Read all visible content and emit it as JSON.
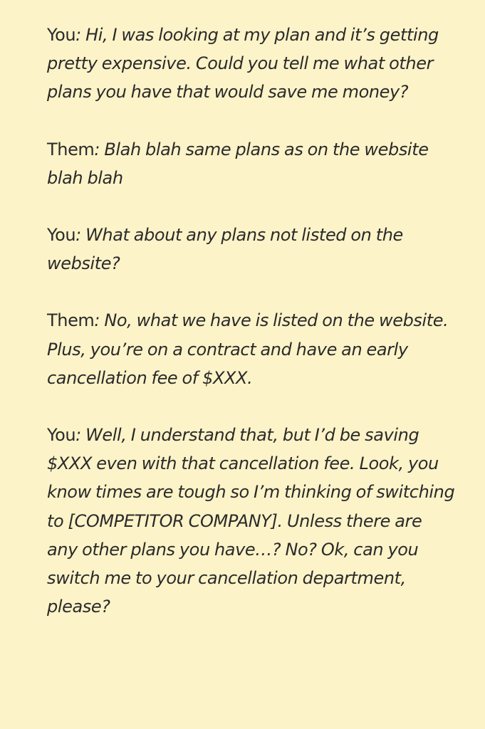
{
  "conversation": [
    {
      "speaker": "You",
      "text": "Hi, I was looking at my plan and it’s getting pretty expensive. Could you tell me what other plans you have that would save me money?"
    },
    {
      "speaker": "Them",
      "text": "Blah blah same plans as on the website blah blah"
    },
    {
      "speaker": "You",
      "text": "What about any plans not listed on the website?"
    },
    {
      "speaker": "Them",
      "text": "No, what we have is listed on the website. Plus, you’re on a contract and have an early cancellation fee of $XXX."
    },
    {
      "speaker": "You",
      "text": "Well, I understand that, but I’d be saving $XXX even with that cancellation fee. Look, you know times are tough so I’m thinking of switching to [COMPETITOR COMPANY]. Unless there are any other plans you have…? No? Ok, can you switch me to your cancellation department, please?"
    }
  ]
}
